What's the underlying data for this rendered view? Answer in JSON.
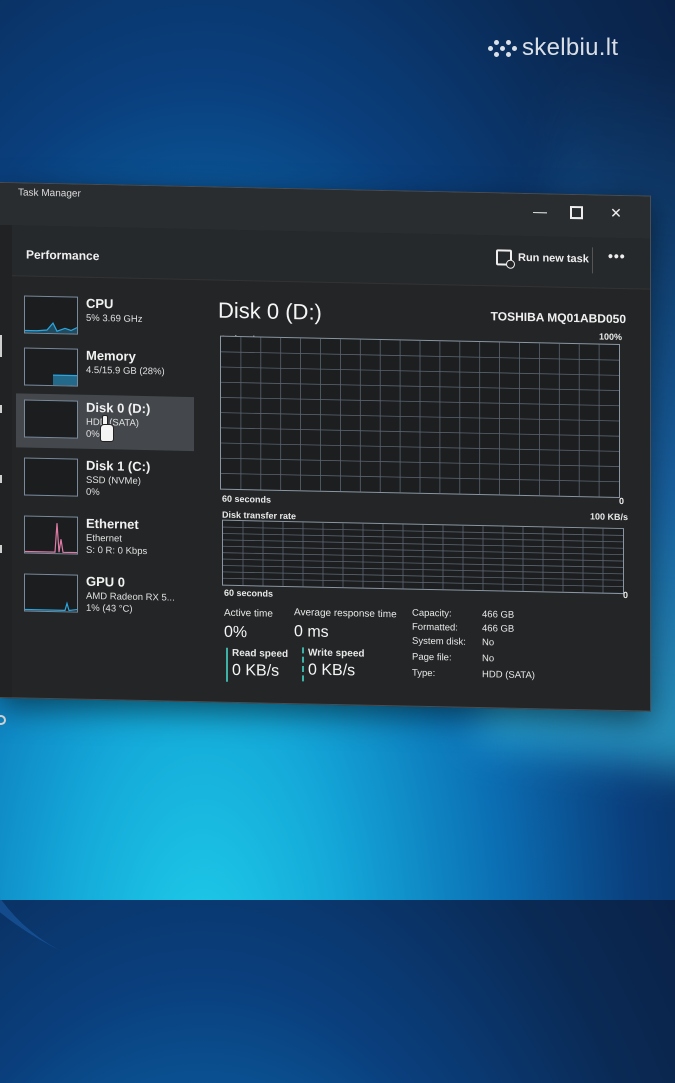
{
  "watermark": {
    "text": "skelbiu.lt"
  },
  "window": {
    "title": "Task Manager",
    "controls": {
      "minimize": "—",
      "close": "✕"
    }
  },
  "header": {
    "section_title": "Performance",
    "run_new_task": "Run new task",
    "more": "•••"
  },
  "sidebar": {
    "items": [
      {
        "name": "CPU",
        "line1": "5% 3.69 GHz",
        "line2": "",
        "selected": false
      },
      {
        "name": "Memory",
        "line1": "4.5/15.9 GB (28%)",
        "line2": "",
        "selected": false
      },
      {
        "name": "Disk 0 (D:)",
        "line1": "HDD (SATA)",
        "line2": "0%",
        "selected": true
      },
      {
        "name": "Disk 1 (C:)",
        "line1": "SSD (NVMe)",
        "line2": "0%",
        "selected": false
      },
      {
        "name": "Ethernet",
        "line1": "Ethernet",
        "line2": "S: 0 R: 0 Kbps",
        "selected": false
      },
      {
        "name": "GPU 0",
        "line1": "AMD Radeon RX 5...",
        "line2": "1% (43 °C)",
        "selected": false
      }
    ]
  },
  "main": {
    "title": "Disk 0 (D:)",
    "model": "TOSHIBA MQ01ABD050",
    "active_graph": {
      "label": "Active time",
      "max": "100%",
      "time": "60 seconds",
      "min": "0"
    },
    "transfer_graph": {
      "label": "Disk transfer rate",
      "max": "100 KB/s",
      "time": "60 seconds",
      "min": "0"
    },
    "stats": {
      "active_time_label": "Active time",
      "active_time_value": "0%",
      "avg_response_label": "Average response time",
      "avg_response_value": "0 ms",
      "read_speed_label": "Read speed",
      "read_speed_value": "0 KB/s",
      "write_speed_label": "Write speed",
      "write_speed_value": "0 KB/s"
    },
    "properties": [
      {
        "key": "Capacity:",
        "value": "466 GB"
      },
      {
        "key": "Formatted:",
        "value": "466 GB"
      },
      {
        "key": "System disk:",
        "value": "No"
      },
      {
        "key": "Page file:",
        "value": "No"
      },
      {
        "key": "Type:",
        "value": "HDD (SATA)"
      }
    ]
  },
  "colors": {
    "window_bg": "#232526",
    "selected_bg": "#44484c",
    "graph_border": "#8a96a4",
    "cpu_accent": "#2aa7e0",
    "ethernet_accent": "#e07ba6",
    "read_speed_accent": "#3fb2a8",
    "write_speed_accent": "#3fb2a8"
  }
}
